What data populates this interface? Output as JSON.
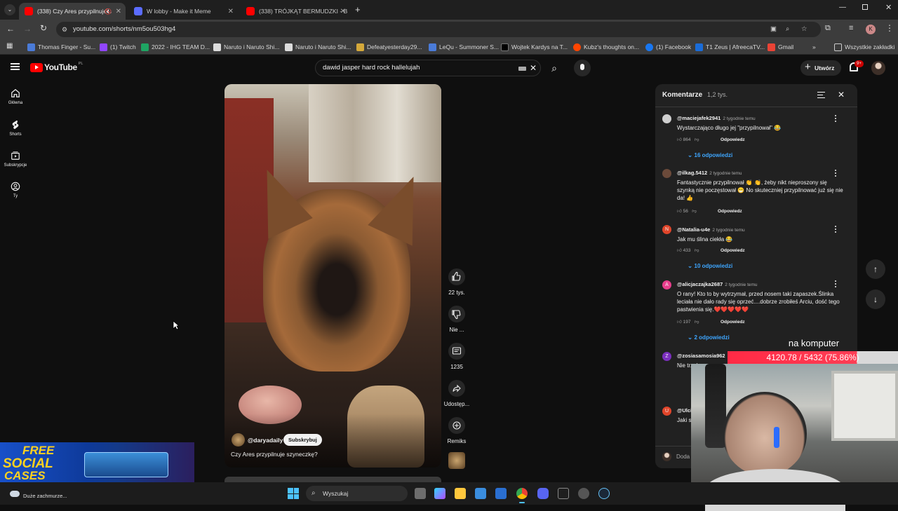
{
  "browser": {
    "tabs": [
      {
        "title": "(338) Czy Ares przypilnuje s",
        "active": true
      },
      {
        "title": "W lobby - Make it Meme",
        "active": false
      },
      {
        "title": "(338) TRÓJKĄT BERMUDZKI - B",
        "active": false
      }
    ],
    "url": "youtube.com/shorts/nm5ou503hg4",
    "bookmarks": [
      "Thomas Finger - Su...",
      "(1) Twitch",
      "2022 - IHG TEAM D...",
      "Naruto i Naruto Shi...",
      "Naruto i Naruto Shi...",
      "Defeatyesterday29...",
      "LeQu - Summoner S...",
      "Wojtek Kardys na T...",
      "Kubz's thoughts on...",
      "(1) Facebook",
      "T1 Zeus | AfreecaTV...",
      "Gmail"
    ],
    "all_bookmarks": "Wszystkie zakładki",
    "profile_letter": "K"
  },
  "youtube": {
    "logo": "YouTube",
    "region": "PL",
    "search_value": "dawid jasper hard rock hallelujah",
    "create_label": "Utwórz",
    "notif_count": "9+",
    "sidebar": [
      {
        "label": "Główna",
        "icon": "home-icon"
      },
      {
        "label": "Shorts",
        "icon": "shorts-icon"
      },
      {
        "label": "Subskrypcje",
        "icon": "subscriptions-icon"
      },
      {
        "label": "Ty",
        "icon": "you-icon"
      }
    ]
  },
  "short": {
    "channel": "@daryadaily",
    "subscribe_label": "Subskrybuj",
    "caption": "Czy Ares przypilnuje szyneczkę?",
    "likes": "22 tys.",
    "dislike_label": "Nie ...",
    "comments": "1235",
    "share_label": "Udostęp...",
    "remix_label": "Remiks"
  },
  "comments": {
    "title": "Komentarze",
    "count": "1,2 tys.",
    "items": [
      {
        "author": "@maciejafek2941",
        "time": "2 tygodnie temu",
        "text": "Wystarczająco długo jej \"przypilnował\" 😂",
        "likes": "864",
        "reply": "Odpowiedz",
        "replies": "16 odpowiedzi",
        "avatar": "#cfcfcf"
      },
      {
        "author": "@ilkag.5412",
        "time": "2 tygodnie temu",
        "text": "Fantastycznie przypilnował 👏 👏, żeby nikt nieproszony się szynką nie poczęstował 😁 No skuteczniej przypilnować już się nie da! 👍",
        "likes": "56",
        "reply": "Odpowiedz",
        "replies": "",
        "avatar": "#6b4a3a"
      },
      {
        "author": "@Natalia-u4e",
        "time": "2 tygodnie temu",
        "text": "Jak mu ślina ciekła 😂",
        "likes": "433",
        "reply": "Odpowiedz",
        "replies": "10 odpowiedzi",
        "avatar": "#e0452a"
      },
      {
        "author": "@alicjaczajka2687",
        "time": "2 tygodnie temu",
        "text": "O rany! Kto to by wytrzymał, przed nosem taki zapaszek.Ślinka leciała nie dało rady się oprzeć....dobrze zrobiłeś Arciu, dość tego pastwienia się.❤️❤️❤️❤️❤️",
        "likes": "197",
        "reply": "Odpowiedz",
        "replies": "2 odpowiedzi",
        "avatar": "#e83e8c"
      },
      {
        "author": "@zosiasamosia962",
        "time": "",
        "text": "Nie trzeba czasu, zanim...",
        "likes": "",
        "reply": "",
        "replies": "",
        "avatar": "#7b2fbe"
      },
      {
        "author": "@Ulci",
        "time": "",
        "text": "Jaki s",
        "likes": "",
        "reply": "",
        "replies": "",
        "avatar": "#e0452a"
      }
    ],
    "add_placeholder": "Doda"
  },
  "overlay": {
    "label": "na komputer",
    "stat": "4120.78 / 5432 (75.86%)",
    "progress": 75.86,
    "promo_line1": "FREE",
    "promo_line2": "SOCIAL",
    "promo_line3": "CASES"
  },
  "taskbar": {
    "weather": "Duże zachmurze...",
    "search": "Wyszukaj"
  }
}
